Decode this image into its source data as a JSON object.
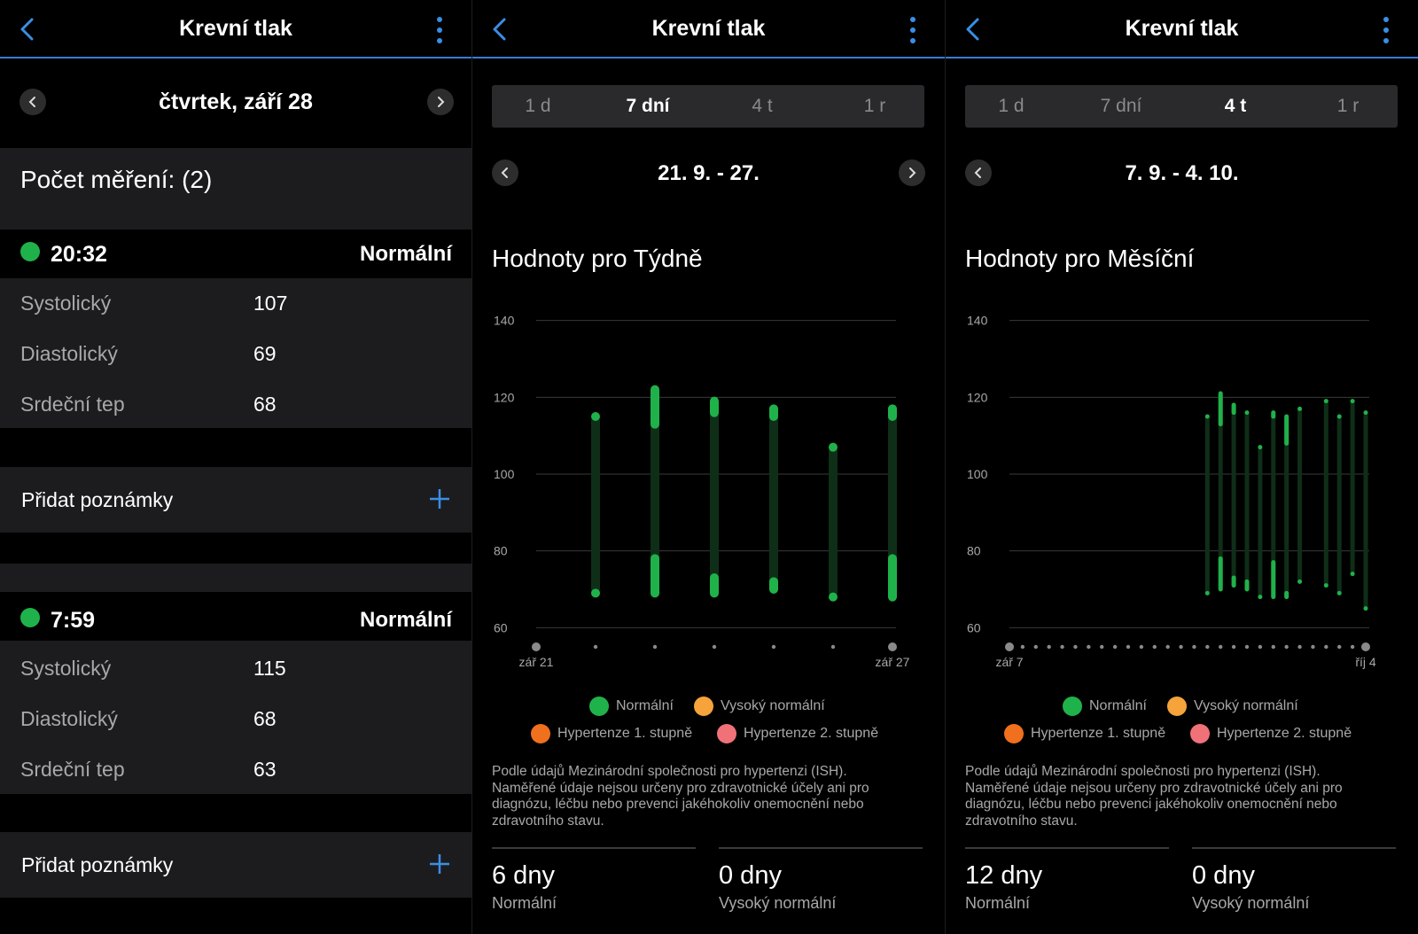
{
  "screens": [
    {
      "title": "Krevní tlak",
      "date": "čtvrtek, září 28",
      "count_label": "Počet měření: (2)",
      "measurements": [
        {
          "time": "20:32",
          "status": "Normální",
          "rows": [
            {
              "label": "Systolický",
              "value": "107"
            },
            {
              "label": "Diastolický",
              "value": "69"
            },
            {
              "label": "Srdeční tep",
              "value": "68"
            }
          ],
          "note_label": "Přidat poznámky"
        },
        {
          "time": "7:59",
          "status": "Normální",
          "rows": [
            {
              "label": "Systolický",
              "value": "115"
            },
            {
              "label": "Diastolický",
              "value": "68"
            },
            {
              "label": "Srdeční tep",
              "value": "63"
            }
          ],
          "note_label": "Přidat poznámky"
        }
      ]
    },
    {
      "title": "Krevní tlak",
      "tabs": [
        "1 d",
        "7 dní",
        "4 t",
        "1 r"
      ],
      "active_tab": 1,
      "range": "21. 9. - 27.",
      "section_title": "Hodnoty pro Týdně",
      "legend": [
        "Normální",
        "Vysoký normální",
        "Hypertenze 1. stupně",
        "Hypertenze 2. stupně"
      ],
      "disclaimer": "Podle údajů Mezinárodní společnosti pro hypertenzi (ISH). Naměřené údaje nejsou určeny pro zdravotnické účely ani pro diagnózu, léčbu nebo prevenci jakéhokoliv onemocnění nebo zdravotního stavu.",
      "stats": [
        {
          "value": "6 dny",
          "label": "Normální"
        },
        {
          "value": "0 dny",
          "label": "Vysoký normální"
        }
      ]
    },
    {
      "title": "Krevní tlak",
      "tabs": [
        "1 d",
        "7 dní",
        "4 t",
        "1 r"
      ],
      "active_tab": 2,
      "range": "7. 9. - 4. 10.",
      "section_title": "Hodnoty pro Měsíční",
      "legend": [
        "Normální",
        "Vysoký normální",
        "Hypertenze 1. stupně",
        "Hypertenze 2. stupně"
      ],
      "disclaimer": "Podle údajů Mezinárodní společnosti pro hypertenzi (ISH). Naměřené údaje nejsou určeny pro zdravotnické účely ani pro diagnózu, léčbu nebo prevenci jakéhokoliv onemocnění nebo zdravotního stavu.",
      "stats": [
        {
          "value": "12 dny",
          "label": "Normální"
        },
        {
          "value": "0 dny",
          "label": "Vysoký normální"
        }
      ]
    }
  ],
  "colors": {
    "accent": "#3a8ee6",
    "normal": "#20b24a",
    "high_normal": "#f5a33a",
    "hyper1": "#f0701e",
    "hyper2": "#f07278",
    "bar_track": "#0f2e18"
  },
  "chart_data": [
    {
      "type": "range-bar",
      "ylim": [
        55,
        145
      ],
      "yticks": [
        60,
        80,
        100,
        120,
        140
      ],
      "x_slots": 7,
      "x_labels": [
        {
          "index": 0,
          "text": "zář 21"
        },
        {
          "index": 6,
          "text": "zář 27"
        }
      ],
      "series": [
        {
          "index": 1,
          "sys_low": 115,
          "sys_high": 115,
          "dia_low": 69,
          "dia_high": 69
        },
        {
          "index": 2,
          "sys_low": 113,
          "sys_high": 122,
          "dia_low": 69,
          "dia_high": 78
        },
        {
          "index": 3,
          "sys_low": 116,
          "sys_high": 119,
          "dia_low": 69,
          "dia_high": 73
        },
        {
          "index": 4,
          "sys_low": 115,
          "sys_high": 117,
          "dia_low": 70,
          "dia_high": 72
        },
        {
          "index": 5,
          "sys_low": 107,
          "sys_high": 107,
          "dia_low": 68,
          "dia_high": 68
        },
        {
          "index": 6,
          "sys_low": 115,
          "sys_high": 117,
          "dia_low": 68,
          "dia_high": 78
        }
      ]
    },
    {
      "type": "range-bar",
      "ylim": [
        55,
        145
      ],
      "yticks": [
        60,
        80,
        100,
        120,
        140
      ],
      "x_slots": 28,
      "x_labels": [
        {
          "index": 0,
          "text": "zář 7"
        },
        {
          "index": 27,
          "text": "říj 4"
        }
      ],
      "series": [
        {
          "index": 15,
          "sys_low": 115,
          "sys_high": 115,
          "dia_low": 69,
          "dia_high": 69
        },
        {
          "index": 16,
          "sys_low": 113,
          "sys_high": 121,
          "dia_low": 70,
          "dia_high": 78
        },
        {
          "index": 17,
          "sys_low": 116,
          "sys_high": 118,
          "dia_low": 71,
          "dia_high": 73
        },
        {
          "index": 18,
          "sys_low": 116,
          "sys_high": 116,
          "dia_low": 70,
          "dia_high": 72
        },
        {
          "index": 19,
          "sys_low": 107,
          "sys_high": 107,
          "dia_low": 68,
          "dia_high": 68
        },
        {
          "index": 20,
          "sys_low": 115,
          "sys_high": 116,
          "dia_low": 68,
          "dia_high": 77
        },
        {
          "index": 21,
          "sys_low": 108,
          "sys_high": 115,
          "dia_low": 68,
          "dia_high": 69
        },
        {
          "index": 22,
          "sys_low": 117,
          "sys_high": 117,
          "dia_low": 72,
          "dia_high": 72
        },
        {
          "index": 24,
          "sys_low": 119,
          "sys_high": 119,
          "dia_low": 71,
          "dia_high": 71
        },
        {
          "index": 25,
          "sys_low": 115,
          "sys_high": 115,
          "dia_low": 69,
          "dia_high": 69
        },
        {
          "index": 26,
          "sys_low": 119,
          "sys_high": 119,
          "dia_low": 74,
          "dia_high": 74
        },
        {
          "index": 27,
          "sys_low": 116,
          "sys_high": 116,
          "dia_low": 65,
          "dia_high": 65
        }
      ]
    }
  ]
}
